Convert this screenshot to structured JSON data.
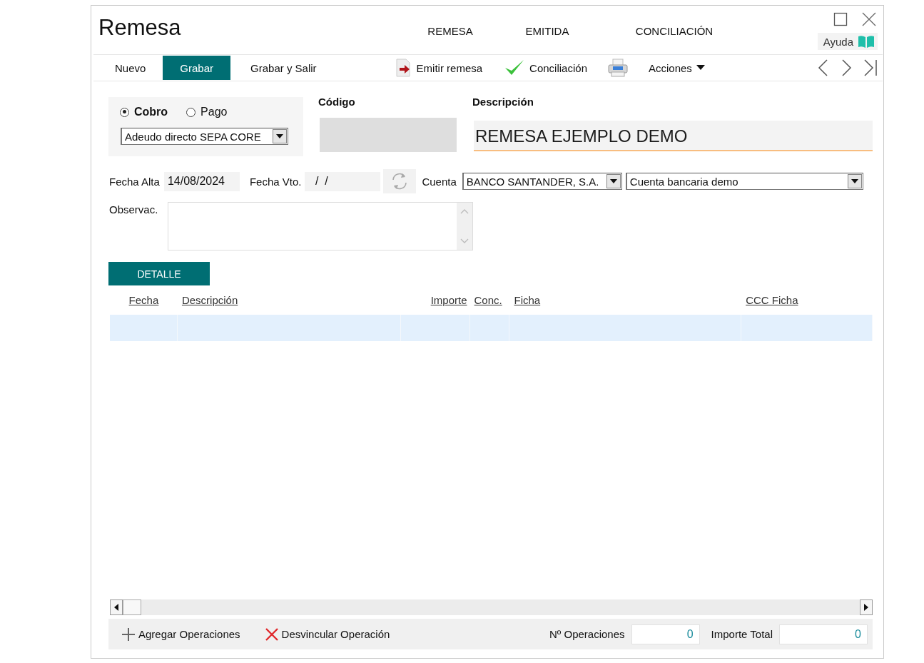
{
  "window": {
    "title": "Remesa"
  },
  "header_tabs": [
    {
      "label": "REMESA"
    },
    {
      "label": "EMITIDA"
    },
    {
      "label": "CONCILIACIÓN"
    }
  ],
  "help_button": {
    "label": "Ayuda"
  },
  "toolbar": [
    {
      "kind": "text",
      "label": "Nuevo",
      "highlighted": false
    },
    {
      "kind": "text",
      "label": "Grabar",
      "highlighted": true
    },
    {
      "kind": "text",
      "label": "Grabar y Salir",
      "highlighted": false
    },
    {
      "kind": "emit",
      "label": "Emitir remesa",
      "highlighted": false
    },
    {
      "kind": "check",
      "label": "Conciliación",
      "highlighted": false
    },
    {
      "kind": "print",
      "highlighted": false
    },
    {
      "kind": "menu",
      "label": "Acciones",
      "highlighted": false
    }
  ],
  "type_radios": [
    {
      "label": "Cobro",
      "selected": true
    },
    {
      "label": "Pago",
      "selected": false
    }
  ],
  "type_select": {
    "value": "Adeudo directo SEPA CORE"
  },
  "codigo": {
    "label": "Código"
  },
  "descripcion": {
    "label": "Descripción",
    "value": "REMESA EJEMPLO DEMO"
  },
  "fecha_alta": {
    "label": "Fecha Alta",
    "value": "14/08/2024"
  },
  "fecha_vto": {
    "label": "Fecha Vto.",
    "value": " /  /"
  },
  "cuenta": {
    "label": "Cuenta",
    "bank": "BANCO SANTANDER, S.A.",
    "account": "Cuenta bancaria demo"
  },
  "observaciones": {
    "label": "Observac."
  },
  "detail_tab": {
    "label": "DETALLE"
  },
  "table": {
    "columns": [
      "Fecha",
      "Descripción",
      "Importe",
      "Conc.",
      "Ficha",
      "CCC Ficha"
    ]
  },
  "footer": {
    "add_button": "Agregar Operaciones",
    "unlink_button": "Desvincular Operación",
    "operations_label": "Nº Operaciones",
    "operations_value": "0",
    "total_label": "Importe Total",
    "total_value": "0"
  }
}
